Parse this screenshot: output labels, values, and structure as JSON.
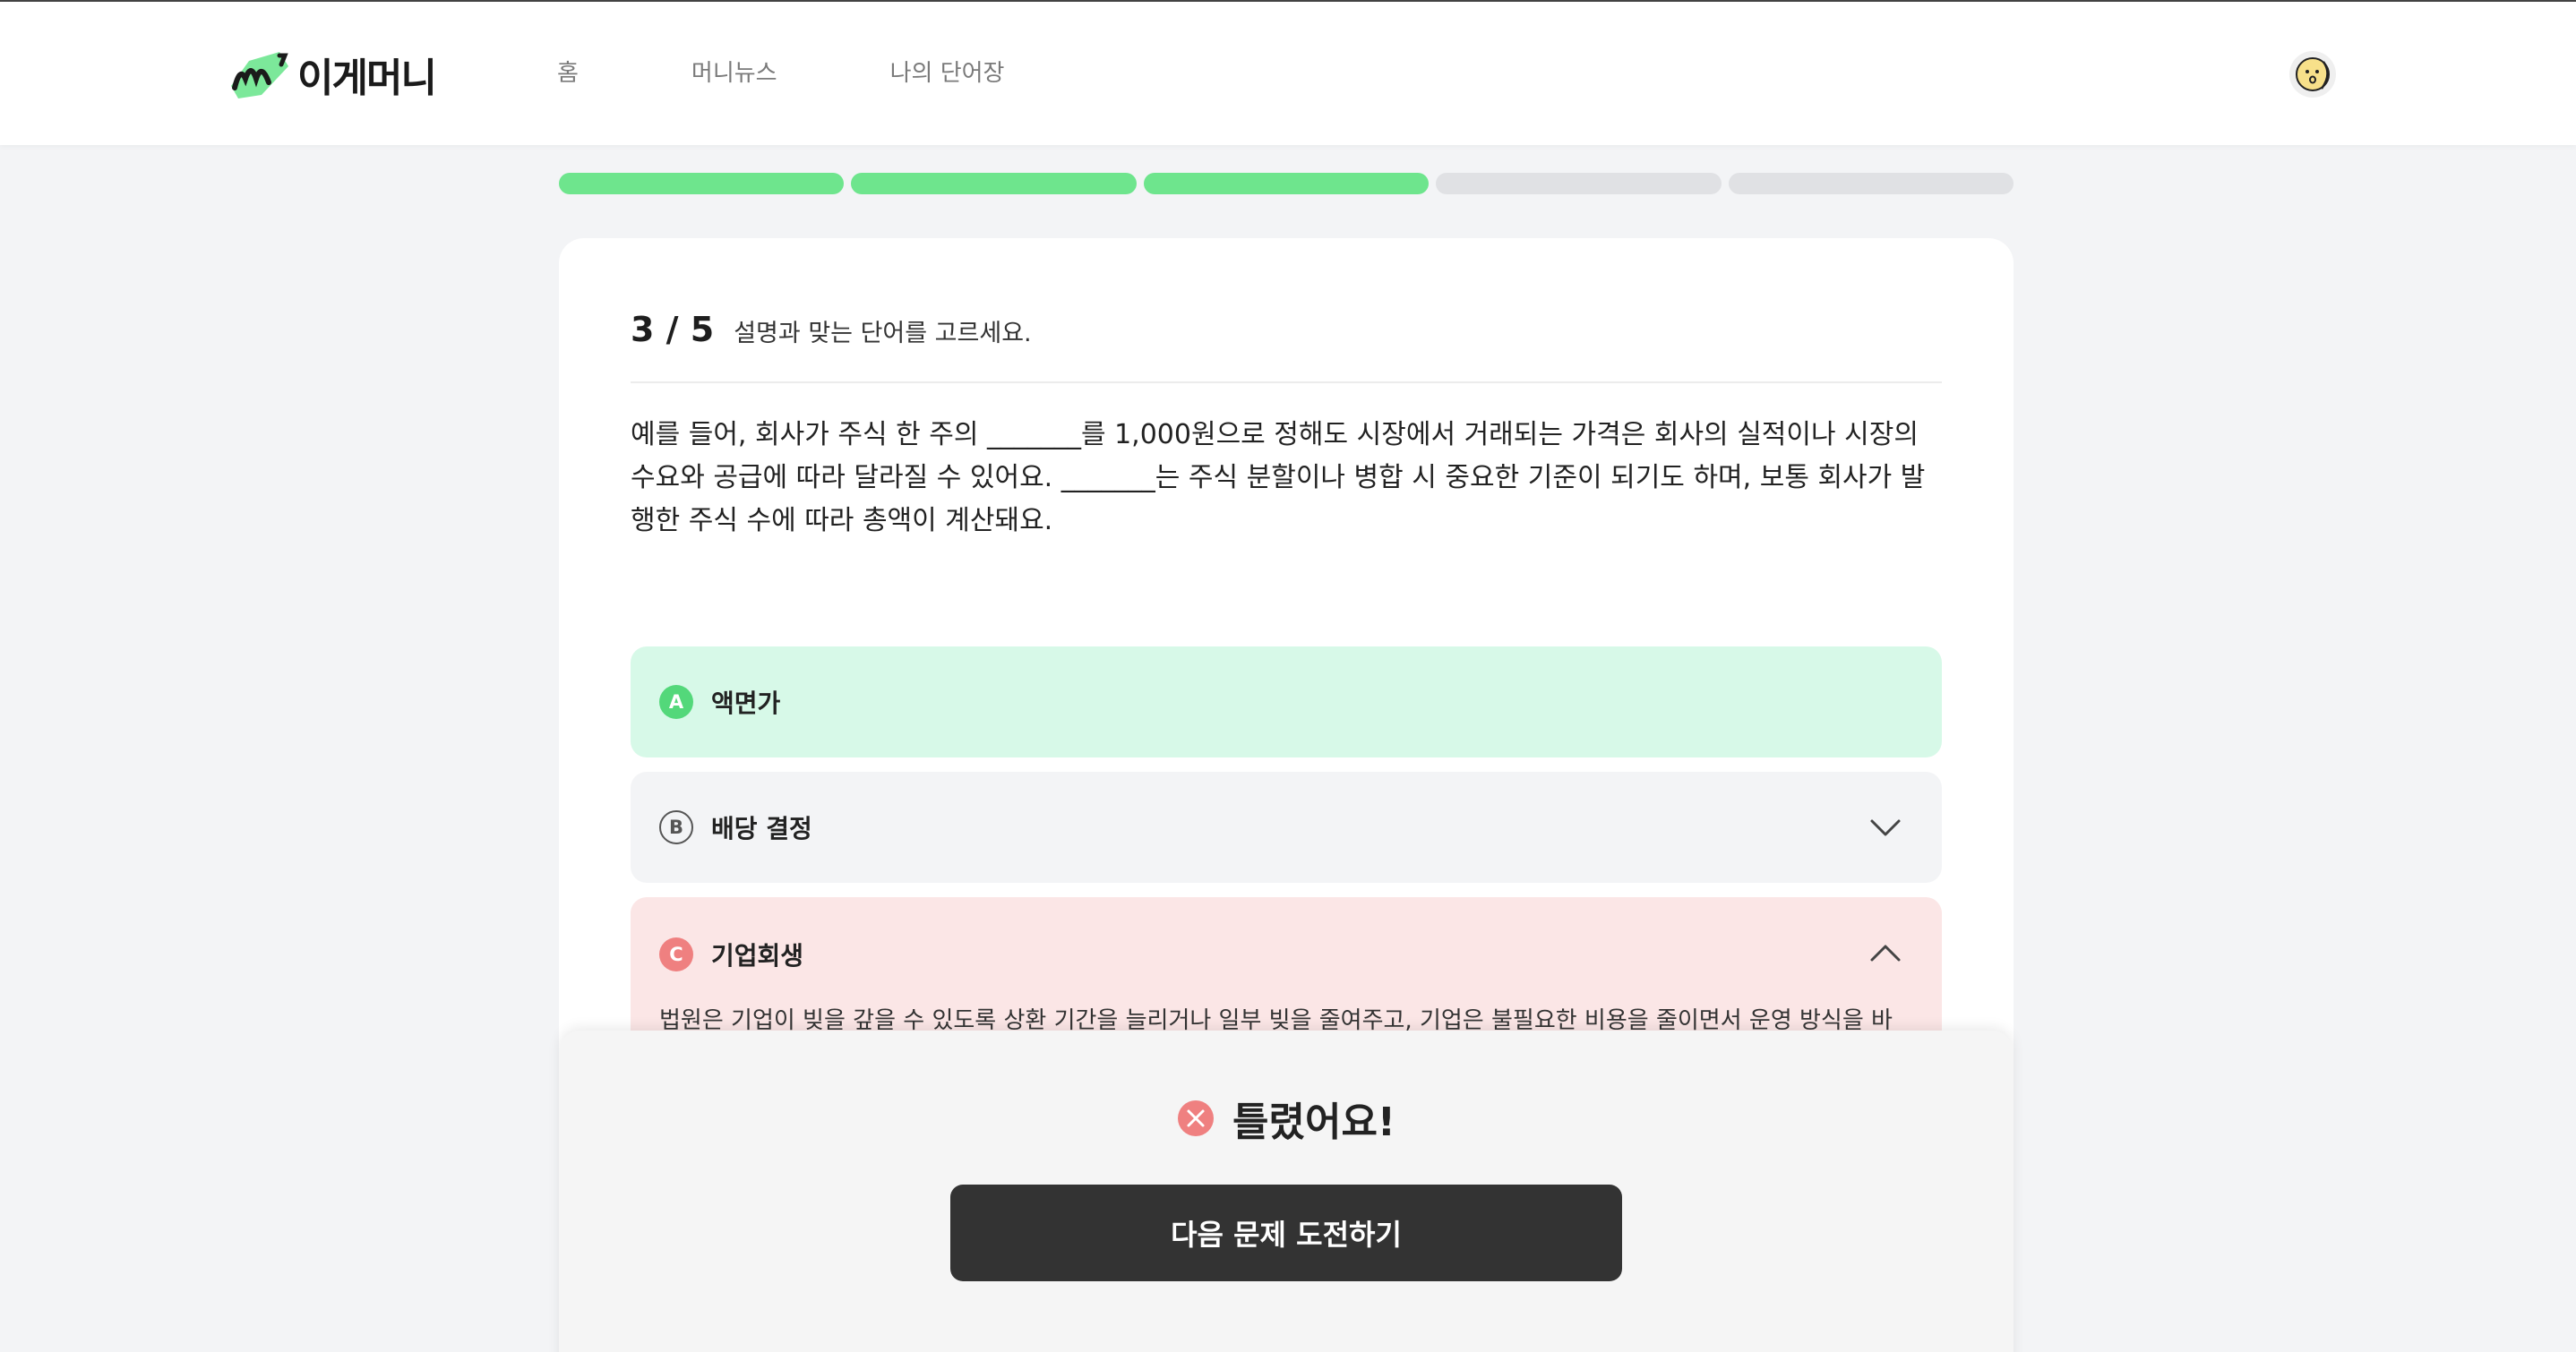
{
  "header": {
    "logo_text": "이게머니",
    "nav": [
      "홈",
      "머니뉴스",
      "나의 단어장"
    ]
  },
  "progress": {
    "current": 3,
    "total": 5
  },
  "question": {
    "number": "3 / 5",
    "instruction": "설명과 맞는 단어를 고르세요.",
    "text": "예를 들어, 회사가 주식 한 주의 _______를 1,000원으로 정해도 시장에서 거래되는 가격은 회사의 실적이나 시장의 수요와 공급에 따라 달라질 수 있어요. _______는 주식 분할이나 병합 시 중요한 기준이 되기도 하며, 보통 회사가 발행한 주식 수에 따라 총액이 계산돼요."
  },
  "options": [
    {
      "letter": "A",
      "label": "액면가",
      "state": "correct"
    },
    {
      "letter": "B",
      "label": "배당 결정",
      "state": "collapsed"
    },
    {
      "letter": "C",
      "label": "기업회생",
      "state": "wrong-expanded",
      "description": "법원은 기업이 빚을 갚을 수 있도록 상환 기간을 늘리거나 일부 빚을 줄여주고, 기업은 불필요한 비용을 줄이면서 운영 방식을 바꿔 다"
    }
  ],
  "result": {
    "text": "틀렸어요!",
    "next_button": "다음 문제 도전하기"
  },
  "colors": {
    "progress_filled": "#6ee58d",
    "correct_bg": "#d7f9e8",
    "wrong_bg": "#fbe6e6",
    "wrong_icon": "#ef8080",
    "button_bg": "#333333"
  }
}
